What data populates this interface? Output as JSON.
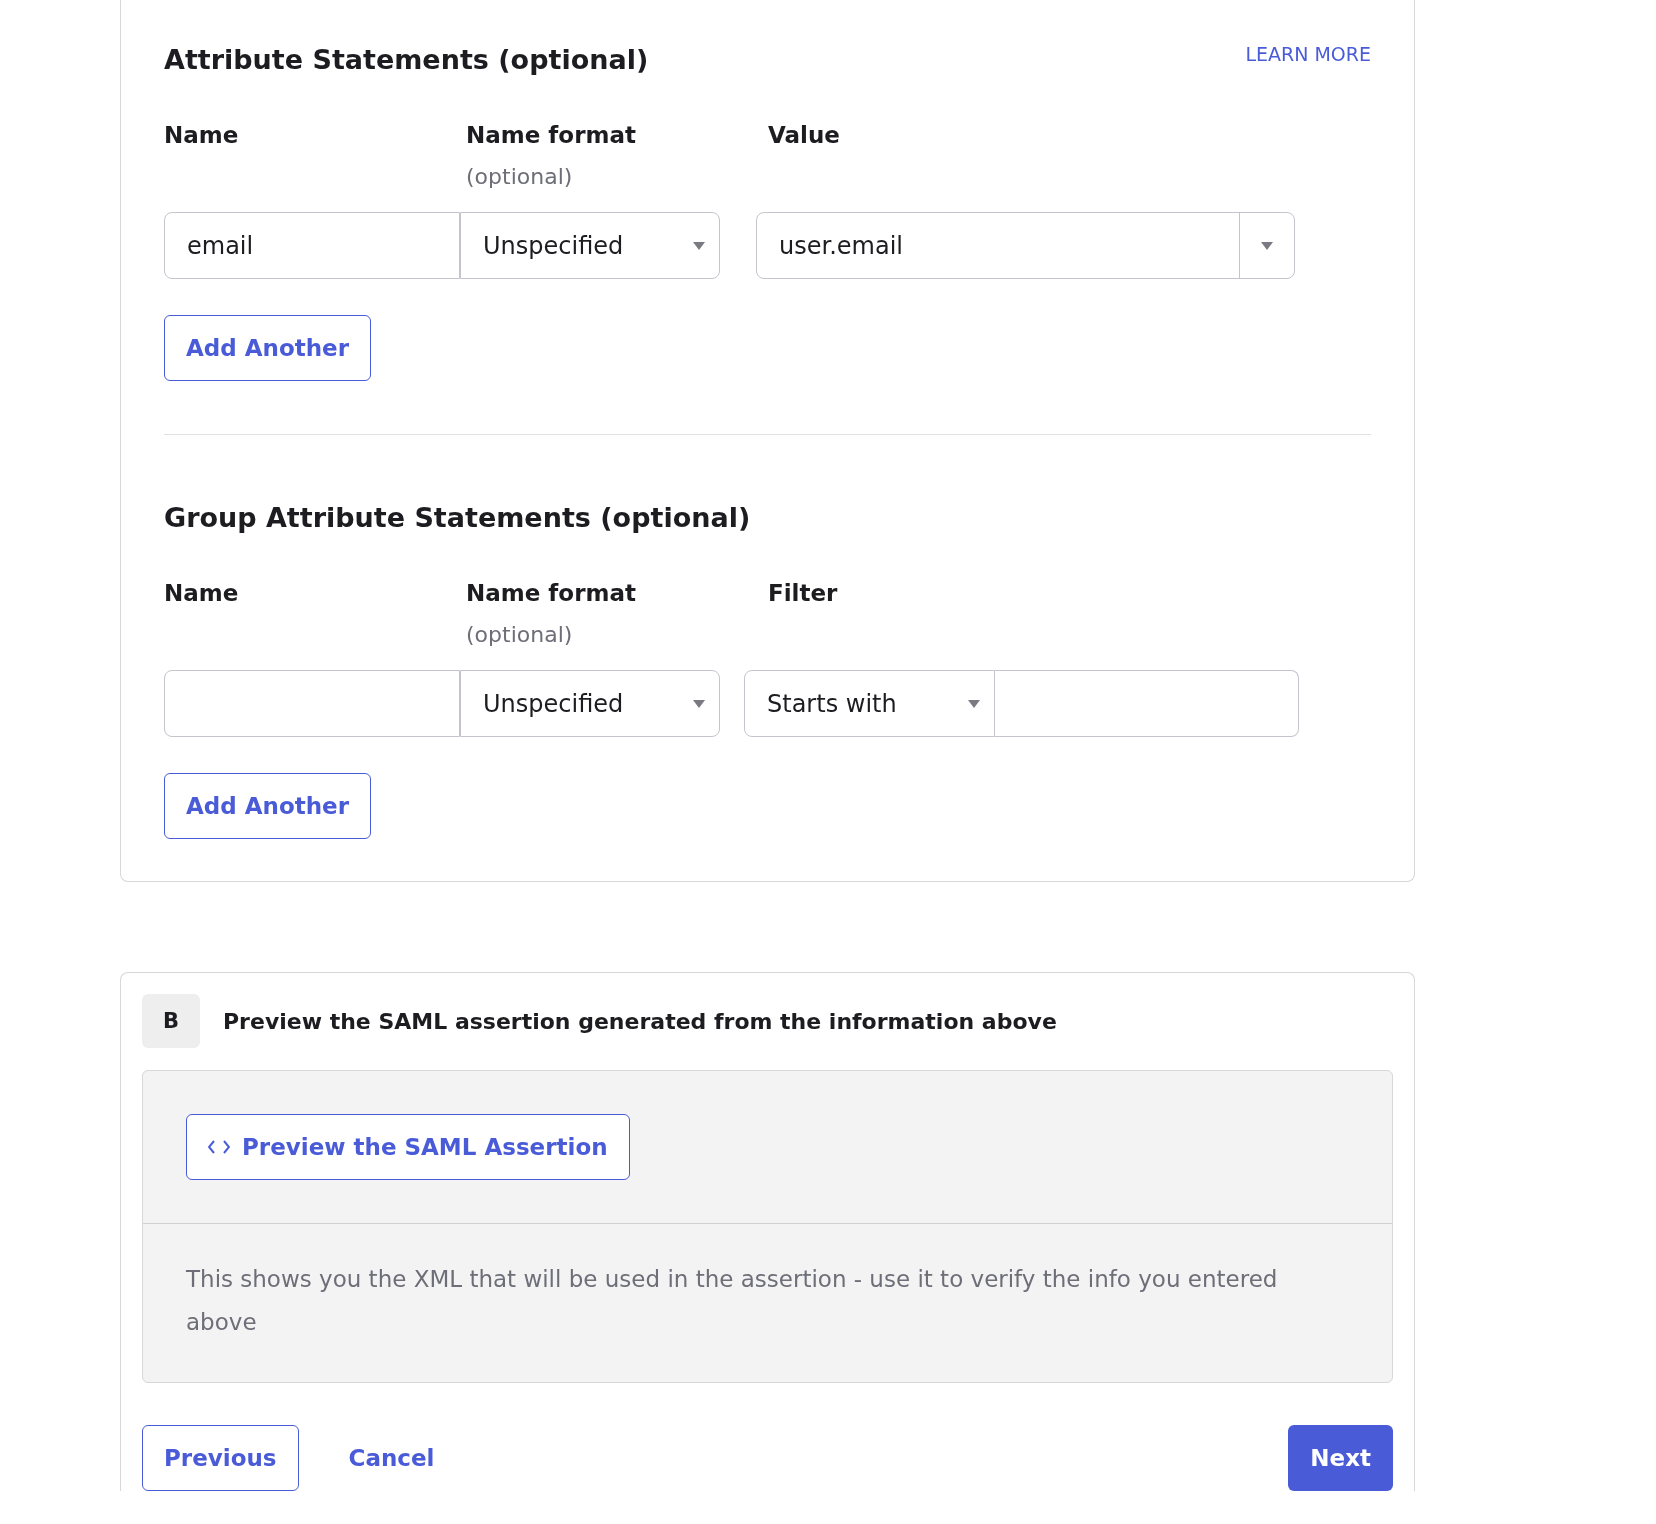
{
  "attribute_statements": {
    "title": "Attribute Statements (optional)",
    "learn_more": "LEARN MORE",
    "columns": [
      {
        "label": "Name"
      },
      {
        "label": "Name format",
        "hint": "(optional)"
      },
      {
        "label": "Value"
      }
    ],
    "row": {
      "name": "email",
      "name_format": "Unspecified",
      "value": "user.email"
    },
    "add_button": "Add Another"
  },
  "group_attribute_statements": {
    "title": "Group Attribute Statements (optional)",
    "columns": [
      {
        "label": "Name"
      },
      {
        "label": "Name format",
        "hint": "(optional)"
      },
      {
        "label": "Filter"
      }
    ],
    "row": {
      "name_format": "Unspecified",
      "filter_type": "Starts with"
    },
    "add_button": "Add Another"
  },
  "preview_section": {
    "step": "B",
    "title": "Preview the SAML assertion generated from the information above",
    "preview_button": "Preview the SAML Assertion",
    "description": "This shows you the XML that will be used in the assertion - use it to verify the info you entered above"
  },
  "footer": {
    "previous": "Previous",
    "cancel": "Cancel",
    "next": "Next"
  }
}
